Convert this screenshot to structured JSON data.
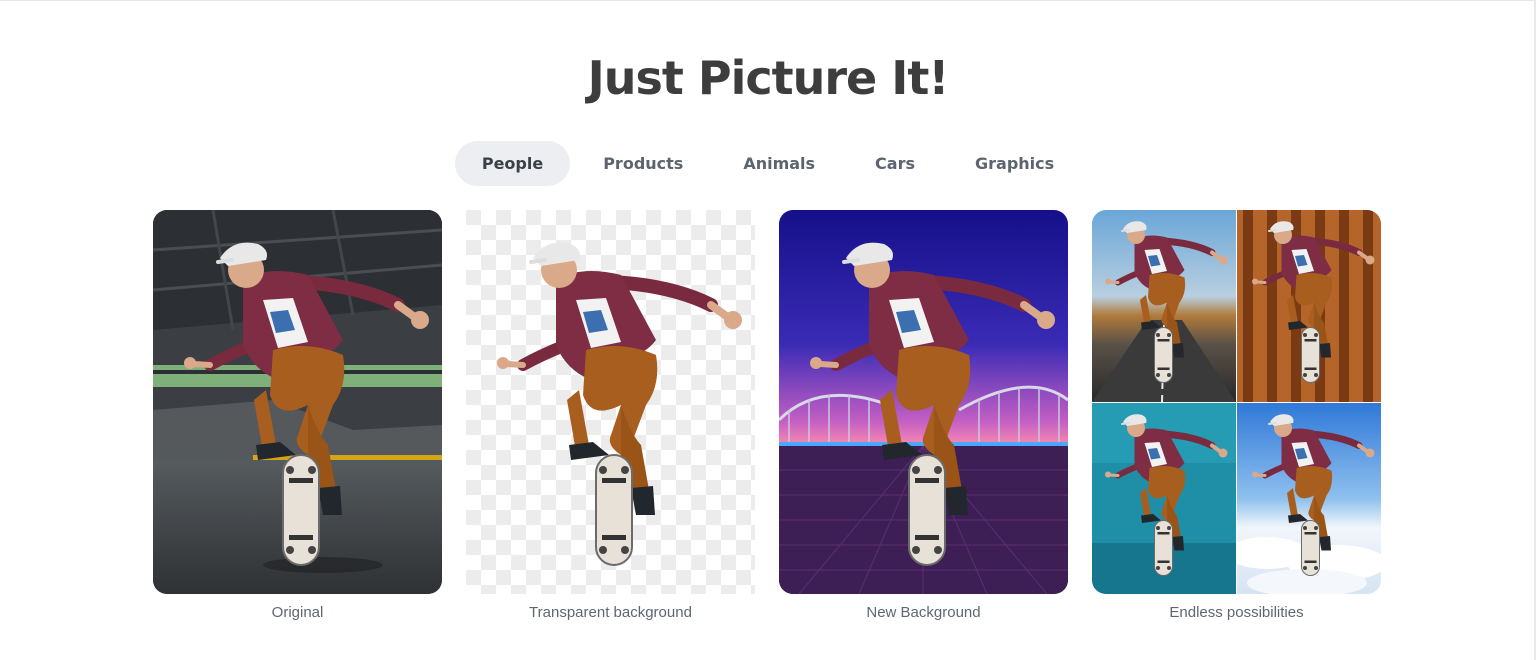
{
  "page": {
    "title": "Just Picture It!"
  },
  "tabs": [
    {
      "label": "People",
      "active": true
    },
    {
      "label": "Products",
      "active": false
    },
    {
      "label": "Animals",
      "active": false
    },
    {
      "label": "Cars",
      "active": false
    },
    {
      "label": "Graphics",
      "active": false
    }
  ],
  "examples": [
    {
      "caption": "Original"
    },
    {
      "caption": "Transparent background"
    },
    {
      "caption": "New Background"
    },
    {
      "caption": "Endless possibilities"
    }
  ],
  "colors": {
    "title": "#3d3d3d",
    "tab_active_bg": "#eceef1",
    "tab_text": "#5c6470",
    "caption": "#5f6670"
  }
}
